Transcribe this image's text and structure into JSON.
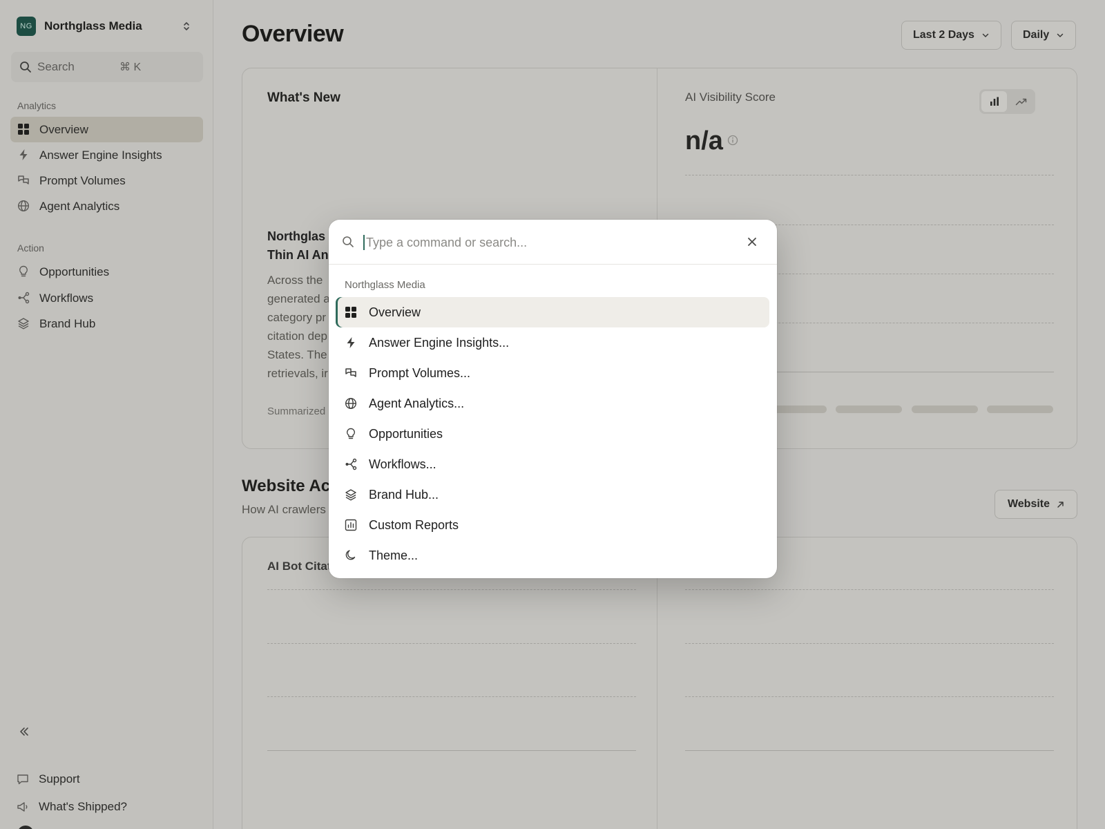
{
  "sidebar": {
    "org": {
      "initials": "NG",
      "name": "Northglass Media"
    },
    "search": {
      "label": "Search",
      "shortcut": "⌘ K"
    },
    "sections": [
      {
        "label": "Analytics",
        "items": [
          {
            "label": "Overview",
            "icon": "grid-icon",
            "active": true
          },
          {
            "label": "Answer Engine Insights",
            "icon": "bolt-icon"
          },
          {
            "label": "Prompt Volumes",
            "icon": "messages-icon"
          },
          {
            "label": "Agent Analytics",
            "icon": "globe-icon"
          }
        ]
      },
      {
        "label": "Action",
        "items": [
          {
            "label": "Opportunities",
            "icon": "lightbulb-icon"
          },
          {
            "label": "Workflows",
            "icon": "workflow-icon"
          },
          {
            "label": "Brand Hub",
            "icon": "layers-icon"
          }
        ]
      }
    ],
    "footer": [
      {
        "label": "Support",
        "icon": "chat-icon"
      },
      {
        "label": "What's Shipped?",
        "icon": "megaphone-icon"
      }
    ]
  },
  "header": {
    "title": "Overview",
    "range": "Last 2 Days",
    "granularity": "Daily"
  },
  "whats_new": {
    "title": "What's New",
    "article_title_lines": [
      "Northglas",
      "Thin AI An"
    ],
    "body_lines": [
      "Across the",
      "generated a",
      "category pr",
      "citation dep",
      "States. The",
      "retrievals, ir"
    ],
    "footer": "Summarized"
  },
  "visibility": {
    "title": "AI Visibility Score",
    "score": "n/a"
  },
  "website_activity": {
    "title": "Website Ac",
    "subtitle": "How AI crawlers",
    "button": "Website",
    "left_card_title": "AI Bot Citat"
  },
  "palette": {
    "placeholder": "Type a command or search...",
    "value": "",
    "group": "Northglass Media",
    "items": [
      {
        "label": "Overview",
        "icon": "grid-icon",
        "active": true
      },
      {
        "label": "Answer Engine Insights...",
        "icon": "bolt-icon"
      },
      {
        "label": "Prompt Volumes...",
        "icon": "messages-icon"
      },
      {
        "label": "Agent Analytics...",
        "icon": "globe-icon"
      },
      {
        "label": "Opportunities",
        "icon": "lightbulb-icon"
      },
      {
        "label": "Workflows...",
        "icon": "workflow-icon"
      },
      {
        "label": "Brand Hub...",
        "icon": "layers-icon"
      },
      {
        "label": "Custom Reports",
        "icon": "report-icon"
      },
      {
        "label": "Theme...",
        "icon": "moon-icon"
      }
    ]
  },
  "colors": {
    "accent": "#2f6b5c",
    "overlay": "#c3c2bf",
    "active_nav": "#b1aea4",
    "palette_active": "#efede8"
  }
}
